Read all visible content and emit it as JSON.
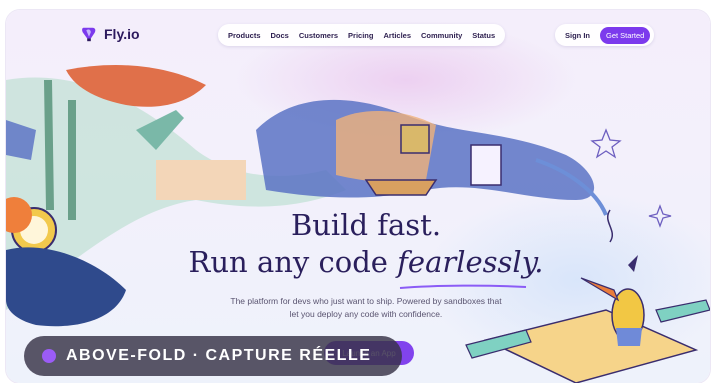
{
  "brand": {
    "name": "Fly.io"
  },
  "nav": {
    "links": [
      "Products",
      "Docs",
      "Customers",
      "Pricing",
      "Articles",
      "Community",
      "Status"
    ]
  },
  "auth": {
    "signin": "Sign In",
    "get_started": "Get Started"
  },
  "hero": {
    "line1": "Build fast.",
    "line2_prefix": "Run any code ",
    "line2_emphasis": "fearlessly.",
    "subtitle_line1": "The platform for devs who just want to ship. Powered by sandboxes that",
    "subtitle_line2": "let you deploy any code with confidence.",
    "cta_label": "Launch an App"
  },
  "overlay_badge": {
    "text": "ABOVE-FOLD · CAPTURE RÉELLE"
  },
  "colors": {
    "accent": "#7c3aed",
    "heading": "#2a1f5c",
    "background": "#f4eefb"
  },
  "icons": [
    "fly-balloon-logo-icon",
    "star-icon",
    "sparkle-icon"
  ]
}
